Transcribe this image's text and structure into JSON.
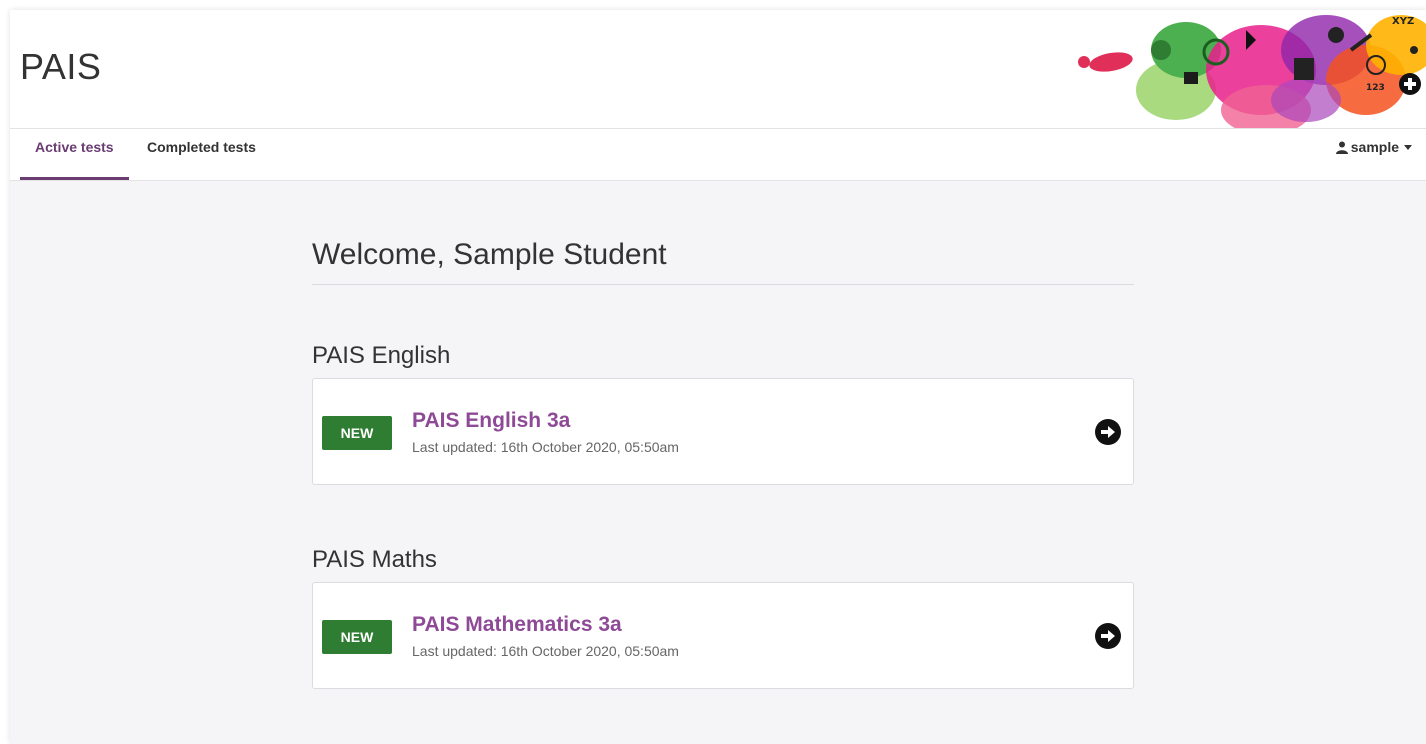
{
  "app": {
    "title": "PAIS"
  },
  "nav": {
    "tabs": [
      {
        "label": "Active tests",
        "active": true
      },
      {
        "label": "Completed tests",
        "active": false
      }
    ],
    "user": {
      "name": "sample",
      "icon": "user-icon"
    }
  },
  "welcome": "Welcome, Sample Student",
  "sections": [
    {
      "title": "PAIS English",
      "tests": [
        {
          "badge": "NEW",
          "name": "PAIS English 3a",
          "updated": "Last updated: 16th October 2020, 05:50am",
          "icon": "arrow-circle-right-icon"
        }
      ]
    },
    {
      "title": "PAIS Maths",
      "tests": [
        {
          "badge": "NEW",
          "name": "PAIS Mathematics 3a",
          "updated": "Last updated: 16th October 2020, 05:50am",
          "icon": "arrow-circle-right-icon"
        }
      ]
    }
  ],
  "colors": {
    "accent": "#6a3c72",
    "test_title": "#8e4a96",
    "badge": "#2e7d32",
    "background": "#f5f5f7"
  }
}
